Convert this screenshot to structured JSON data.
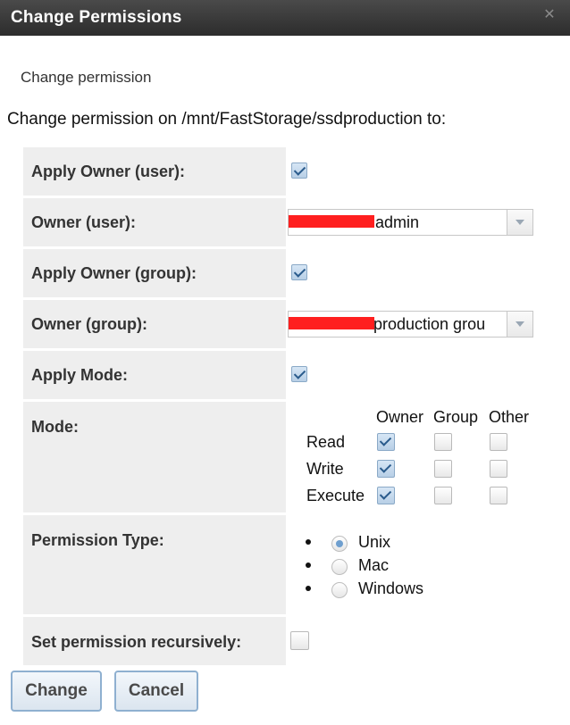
{
  "dialog": {
    "title": "Change Permissions",
    "subtitle": "Change permission",
    "intro": "Change permission on /mnt/FastStorage/ssdproduction to:"
  },
  "form": {
    "apply_owner_user": {
      "label": "Apply Owner (user):",
      "checked": true
    },
    "owner_user": {
      "label": "Owner (user):",
      "value": "admin"
    },
    "apply_owner_group": {
      "label": "Apply Owner (group):",
      "checked": true
    },
    "owner_group": {
      "label": "Owner (group):",
      "value": "production grou"
    },
    "apply_mode": {
      "label": "Apply Mode:",
      "checked": true
    },
    "mode": {
      "label": "Mode:",
      "columns": [
        "Owner",
        "Group",
        "Other"
      ],
      "rows": [
        {
          "label": "Read",
          "values": [
            true,
            false,
            false
          ]
        },
        {
          "label": "Write",
          "values": [
            true,
            false,
            false
          ]
        },
        {
          "label": "Execute",
          "values": [
            true,
            false,
            false
          ]
        }
      ]
    },
    "permission_type": {
      "label": "Permission Type:",
      "options": [
        "Unix",
        "Mac",
        "Windows"
      ],
      "selected": "Unix"
    },
    "recursive": {
      "label": "Set permission recursively:",
      "checked": false
    }
  },
  "buttons": {
    "change": "Change",
    "cancel": "Cancel"
  },
  "icons": {
    "close": "close-icon"
  }
}
